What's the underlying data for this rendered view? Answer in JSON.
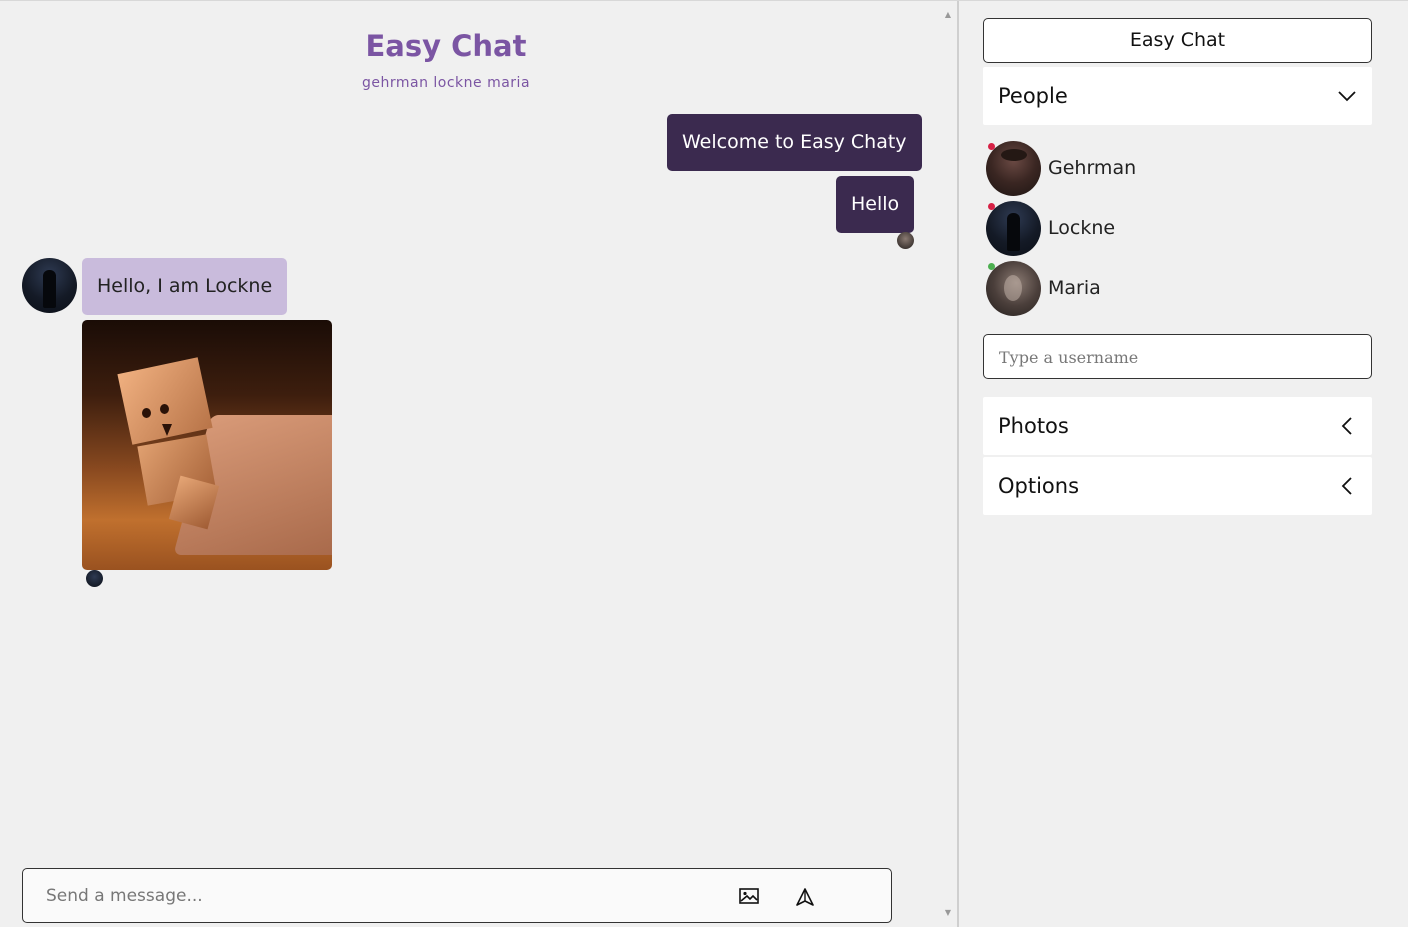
{
  "chat": {
    "title": "Easy Chat",
    "members": "gehrman lockne maria",
    "messages": [
      {
        "side": "out",
        "text": "Welcome to Easy Chaty"
      },
      {
        "side": "out",
        "text": "Hello"
      },
      {
        "side": "in",
        "sender": "Lockne",
        "text": "Hello, I am Lockne"
      }
    ],
    "composer": {
      "placeholder": "Send a message...",
      "image_icon": "image-icon",
      "send_icon": "send-icon"
    }
  },
  "sidebar": {
    "brand_label": "Easy Chat",
    "people_label": "People",
    "people": [
      {
        "name": "Gehrman",
        "status_color": "#d62246"
      },
      {
        "name": "Lockne",
        "status_color": "#d62246"
      },
      {
        "name": "Maria",
        "status_color": "#4caf50"
      }
    ],
    "username_placeholder": "Type a username",
    "photos_label": "Photos",
    "options_label": "Options"
  },
  "colors": {
    "accent": "#7b55a3",
    "outgoing_bubble": "#3b2a4f",
    "incoming_bubble": "#c9bbdc"
  }
}
